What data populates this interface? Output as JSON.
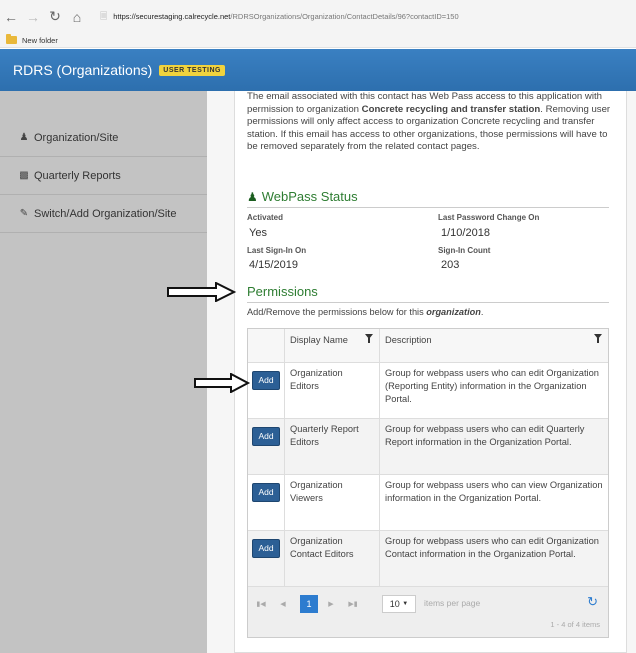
{
  "browser": {
    "url_domain": "https://securestaging.calrecycle.net",
    "url_path": "/RDRSOrganizations/Organization/ContactDetails/96?contactID=150",
    "bookmark": "New folder"
  },
  "app": {
    "title": "RDRS (Organizations)",
    "badge": "USER TESTING"
  },
  "sidebar": {
    "items": [
      {
        "label": "Organization/Site",
        "icon": "user-icon"
      },
      {
        "label": "Quarterly Reports",
        "icon": "bar-chart-icon"
      },
      {
        "label": "Switch/Add Organization/Site",
        "icon": "edit-icon"
      }
    ]
  },
  "intro": {
    "part1": "The email associated with this contact has Web Pass access to this application with permission to organization ",
    "org": "Concrete recycling and transfer station",
    "part2": ". Removing user permissions will only affect access to organization Concrete recycling and transfer station. If this email has access to other organizations, those permissions will have to be removed separately from the related contact pages."
  },
  "webpass": {
    "title": "WebPass Status",
    "activated_label": "Activated",
    "activated_value": "Yes",
    "last_pw_label": "Last Password Change On",
    "last_pw_value": "1/10/2018",
    "last_signin_label": "Last Sign-In On",
    "last_signin_value": "4/15/2019",
    "signin_count_label": "Sign-In Count",
    "signin_count_value": "203"
  },
  "permissions": {
    "title": "Permissions",
    "text_before": "Add/Remove the permissions below for this ",
    "text_emph": "organization",
    "text_after": ".",
    "columns": {
      "display_name": "Display Name",
      "description": "Description"
    },
    "add_label": "Add",
    "rows": [
      {
        "name": "Organization Editors",
        "description": "Group for webpass users who can edit Organization (Reporting Entity) information in the Organization Portal."
      },
      {
        "name": "Quarterly Report Editors",
        "description": "Group for webpass users who can edit Quarterly Report information in the Organization Portal."
      },
      {
        "name": "Organization Viewers",
        "description": "Group for webpass users who can view Organization information in the Organization Portal."
      },
      {
        "name": "Organization Contact Editors",
        "description": "Group for webpass users who can edit Organization Contact information in the Organization Portal."
      }
    ],
    "pager": {
      "current_page": "1",
      "page_size": "10",
      "items_per_page_label": "items per page",
      "count_text": "1 - 4 of 4 items"
    }
  }
}
